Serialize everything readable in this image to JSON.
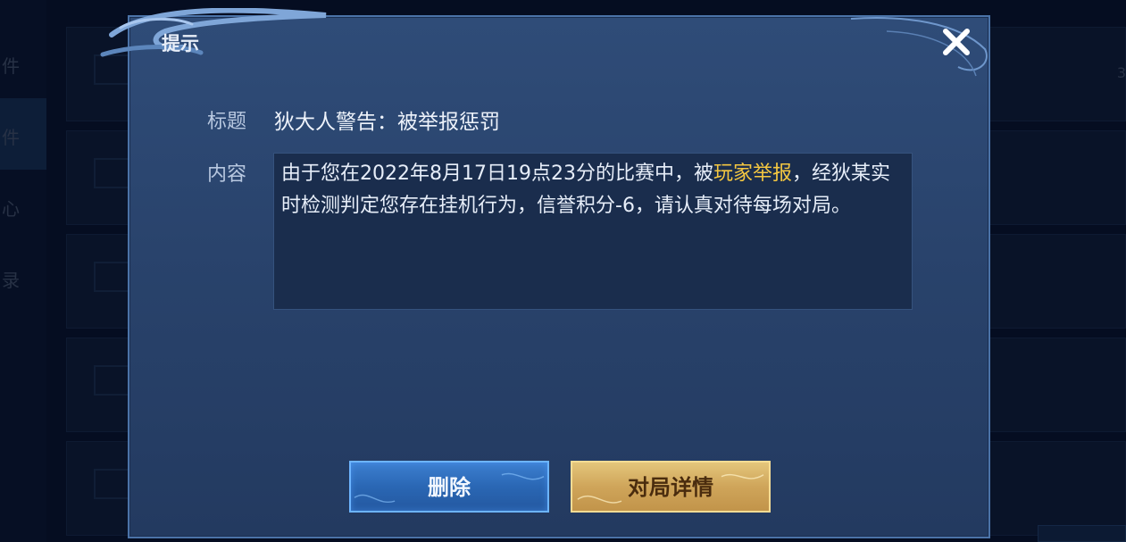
{
  "background": {
    "sidebar_items": [
      "件",
      "件",
      "心",
      "录"
    ],
    "right_number": "3"
  },
  "dialog": {
    "title": "提示",
    "subject_label": "标题",
    "subject_value": "狄大人警告：被举报惩罚",
    "content_label": "内容",
    "content": {
      "prefix": "由于您在2022年8月17日19点23分的比赛中，被",
      "highlight": "玩家举报",
      "suffix": "，经狄某实时检测判定您存在挂机行为，信誉积分-6，请认真对待每场对局。"
    },
    "buttons": {
      "delete": "删除",
      "match_details": "对局详情"
    },
    "icons": {
      "close": "close-icon"
    }
  },
  "colors": {
    "highlight": "#f4c741",
    "delete_button": "#2a67b4",
    "details_button": "#cfa55a",
    "dialog_bg": "#2f4c78"
  }
}
